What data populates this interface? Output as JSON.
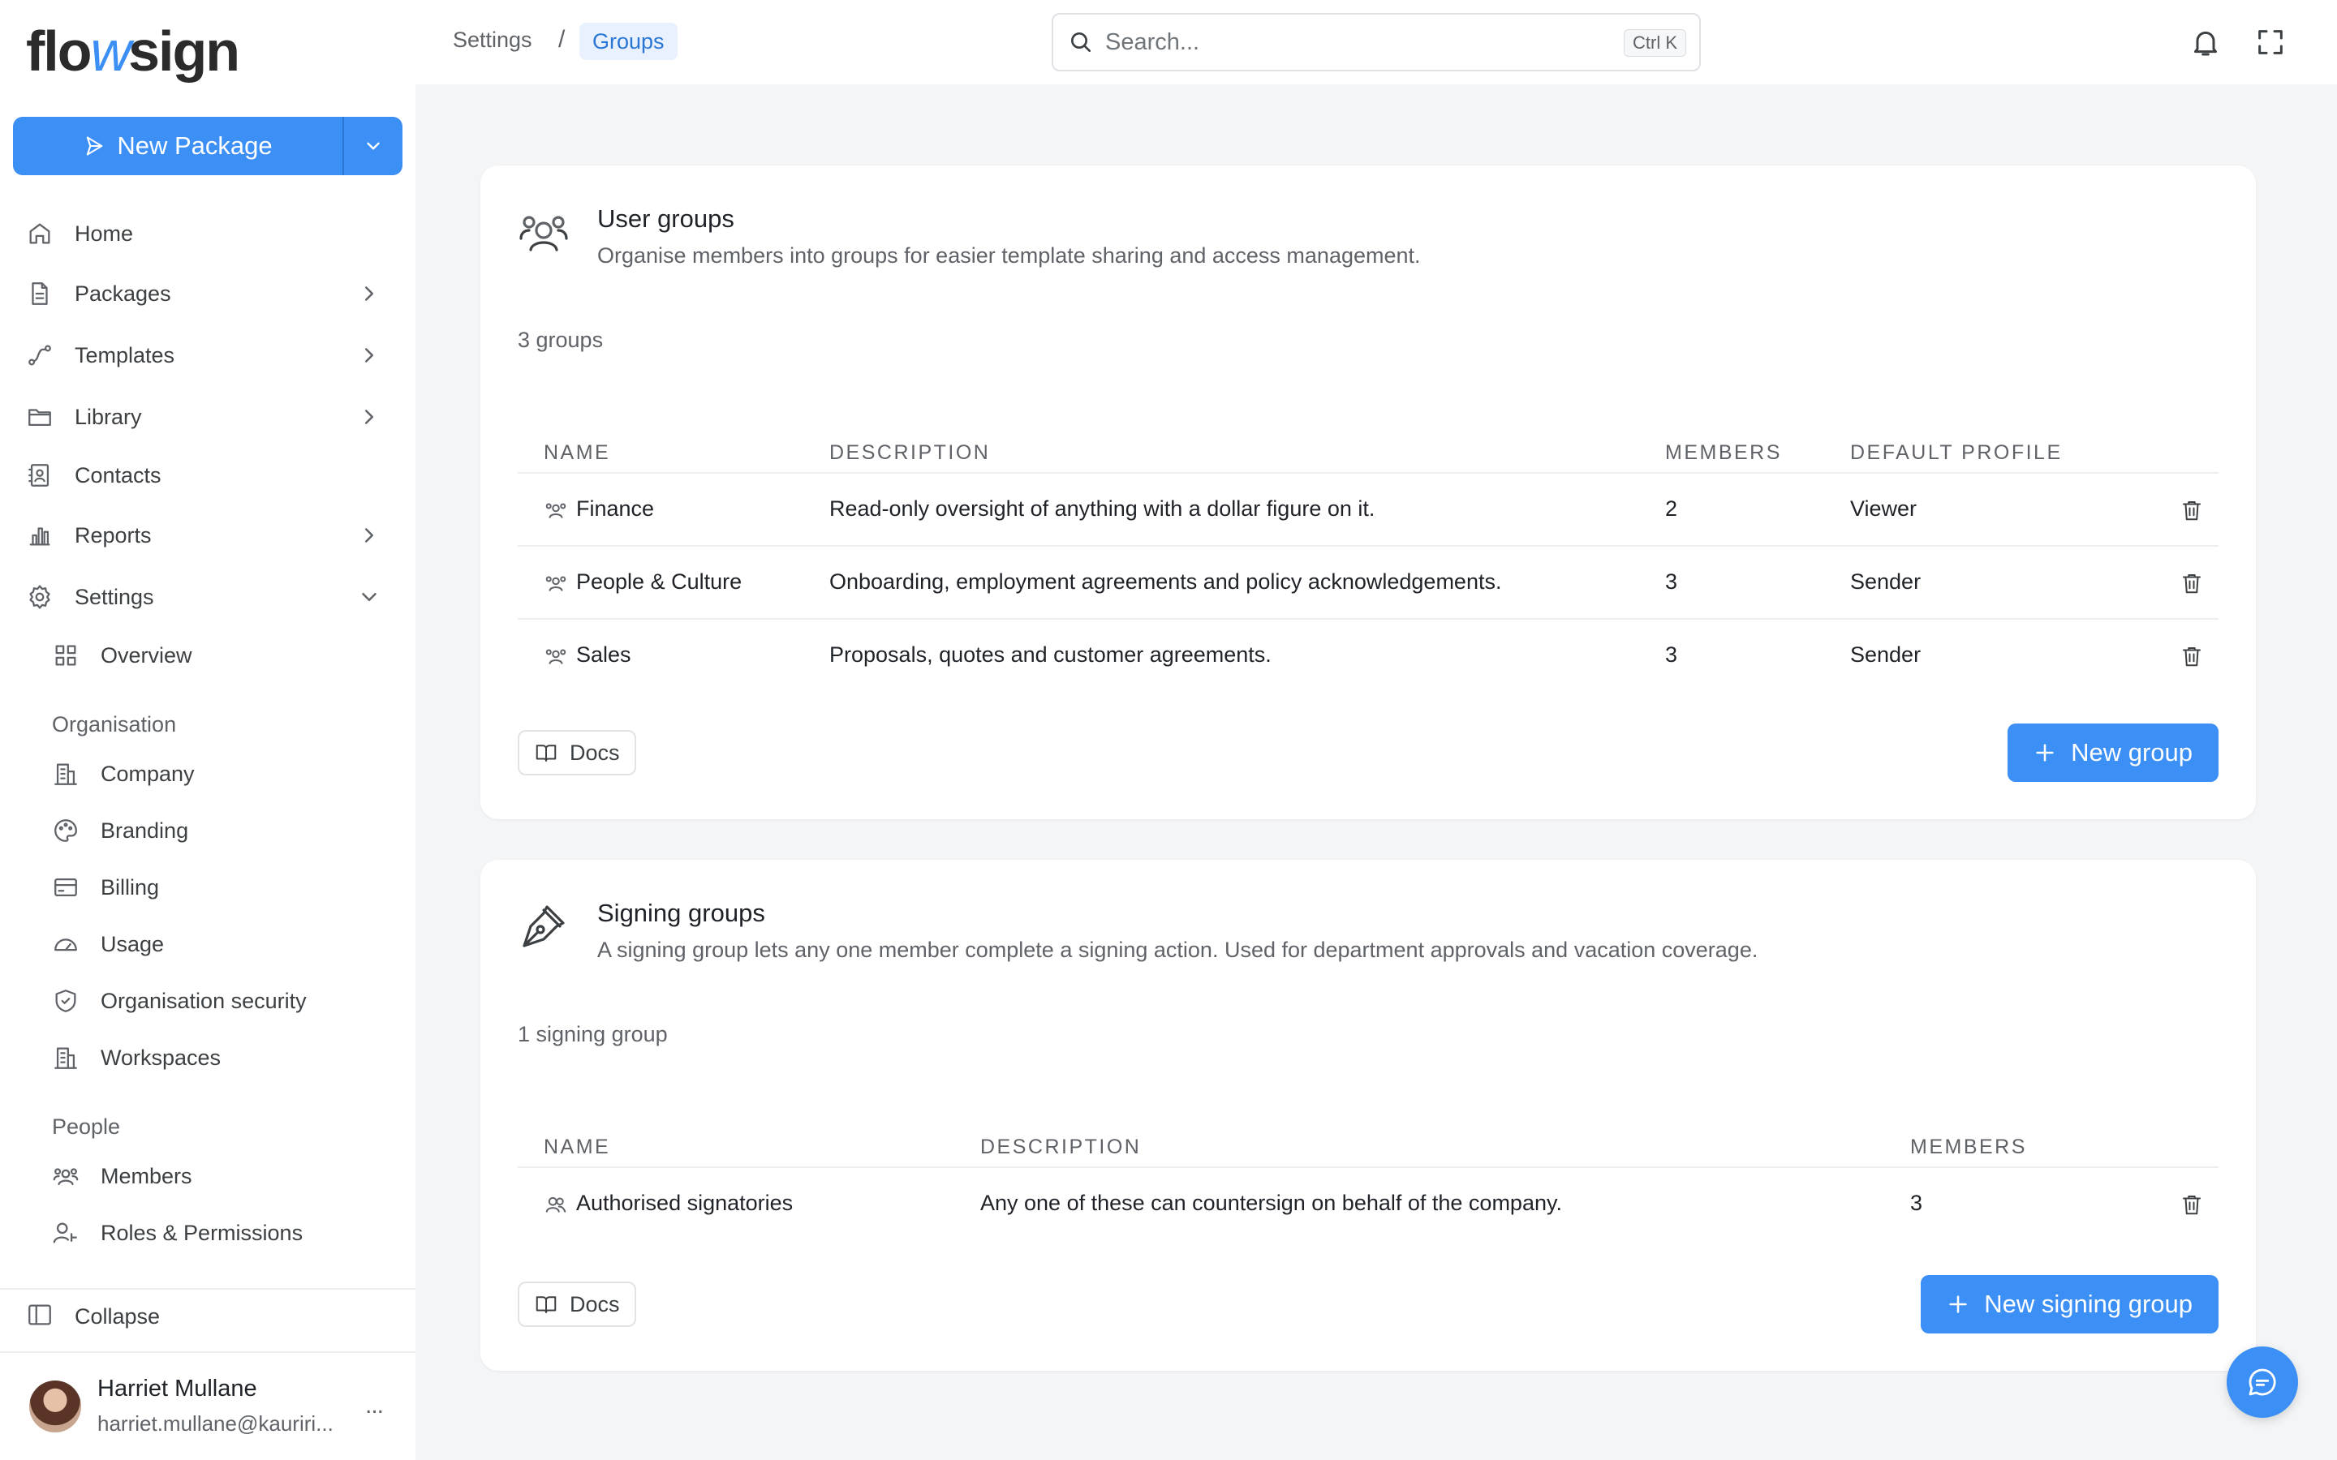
{
  "app": {
    "logo_text_a": "flo",
    "logo_text_b": "w",
    "logo_text_c": "sign"
  },
  "sidebar": {
    "new_package_label": "New Package",
    "items": [
      {
        "label": "Home",
        "icon": "home-icon"
      },
      {
        "label": "Packages",
        "icon": "document-icon"
      },
      {
        "label": "Templates",
        "icon": "workflow-icon"
      },
      {
        "label": "Library",
        "icon": "folder-icon"
      },
      {
        "label": "Contacts",
        "icon": "contact-book-icon"
      },
      {
        "label": "Reports",
        "icon": "bar-chart-icon"
      },
      {
        "label": "Settings",
        "icon": "gear-icon"
      }
    ],
    "settings_overview": "Overview",
    "section_organisation": "Organisation",
    "organisation_items": [
      {
        "label": "Company",
        "icon": "building-icon"
      },
      {
        "label": "Branding",
        "icon": "palette-icon"
      },
      {
        "label": "Billing",
        "icon": "credit-card-icon"
      },
      {
        "label": "Usage",
        "icon": "gauge-icon"
      },
      {
        "label": "Organisation security",
        "icon": "shield-icon"
      },
      {
        "label": "Workspaces",
        "icon": "building-icon"
      }
    ],
    "section_people": "People",
    "people_items": [
      {
        "label": "Members",
        "icon": "users-icon"
      },
      {
        "label": "Roles & Permissions",
        "icon": "user-key-icon"
      }
    ],
    "collapse_label": "Collapse",
    "user": {
      "name": "Harriet Mullane",
      "email": "harriet.mullane@kauriri...",
      "more": "..."
    }
  },
  "topbar": {
    "breadcrumb": [
      "Settings",
      "Groups"
    ],
    "breadcrumb_sep": "/",
    "search_placeholder": "Search...",
    "search_shortcut": "Ctrl K"
  },
  "user_groups": {
    "title": "User groups",
    "description": "Organise members into groups for easier template sharing and access management.",
    "count_label": "3 groups",
    "columns": [
      "NAME",
      "DESCRIPTION",
      "MEMBERS",
      "DEFAULT PROFILE"
    ],
    "rows": [
      {
        "name": "Finance",
        "description": "Read-only oversight of anything with a dollar figure on it.",
        "members": "2",
        "profile": "Viewer"
      },
      {
        "name": "People & Culture",
        "description": "Onboarding, employment agreements and policy acknowledgements.",
        "members": "3",
        "profile": "Sender"
      },
      {
        "name": "Sales",
        "description": "Proposals, quotes and customer agreements.",
        "members": "3",
        "profile": "Sender"
      }
    ],
    "docs_label": "Docs",
    "new_button": "New group"
  },
  "signing_groups": {
    "title": "Signing groups",
    "description": "A signing group lets any one member complete a signing action. Used for department approvals and vacation coverage.",
    "count_label": "1 signing group",
    "columns": [
      "NAME",
      "DESCRIPTION",
      "MEMBERS"
    ],
    "rows": [
      {
        "name": "Authorised signatories",
        "description": "Any one of these can countersign on behalf of the company.",
        "members": "3"
      }
    ],
    "docs_label": "Docs",
    "new_button": "New signing group"
  },
  "colors": {
    "accent": "#3b8ff5",
    "background": "#f4f5f7",
    "text": "#1f2328",
    "muted": "#5f6368"
  }
}
